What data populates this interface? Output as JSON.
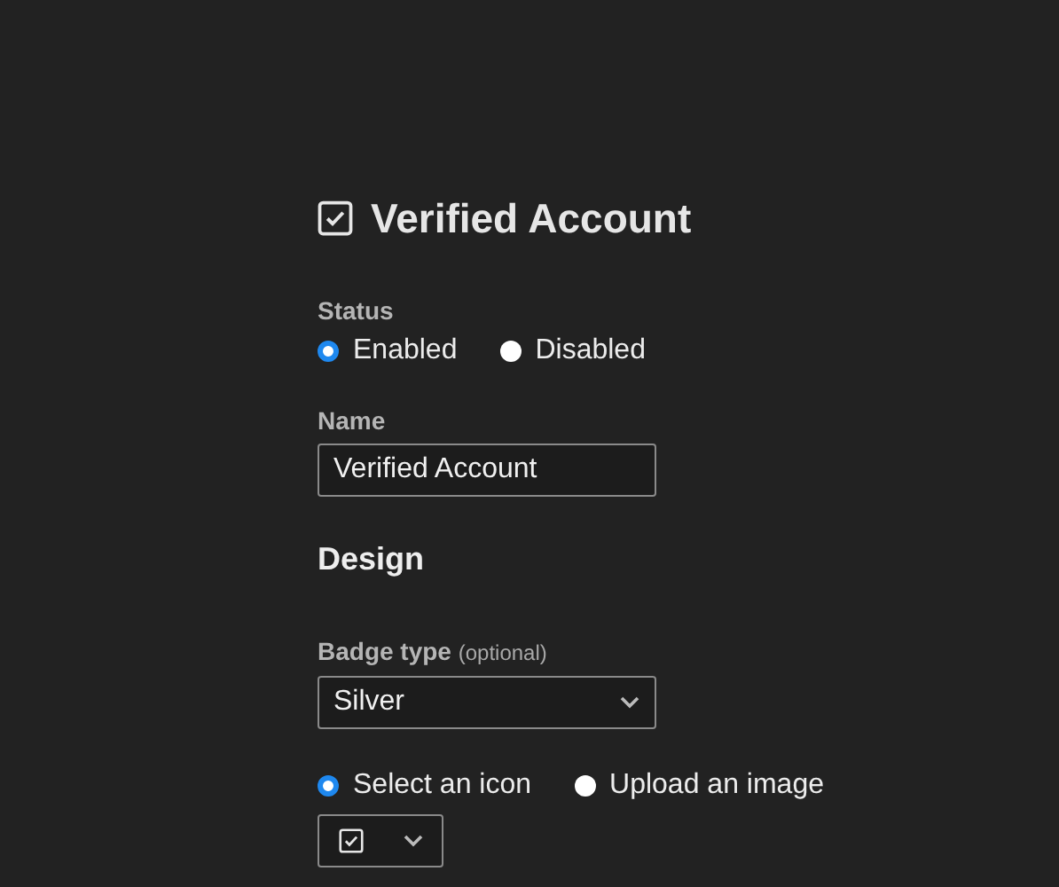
{
  "title": "Verified Account",
  "status": {
    "label": "Status",
    "options": [
      {
        "label": "Enabled",
        "selected": true
      },
      {
        "label": "Disabled",
        "selected": false
      }
    ]
  },
  "name": {
    "label": "Name",
    "value": "Verified Account"
  },
  "design": {
    "heading": "Design",
    "badge_type": {
      "label": "Badge type",
      "hint": "(optional)",
      "value": "Silver"
    },
    "icon_source": [
      {
        "label": "Select an icon",
        "selected": true
      },
      {
        "label": "Upload an image",
        "selected": false
      }
    ]
  }
}
